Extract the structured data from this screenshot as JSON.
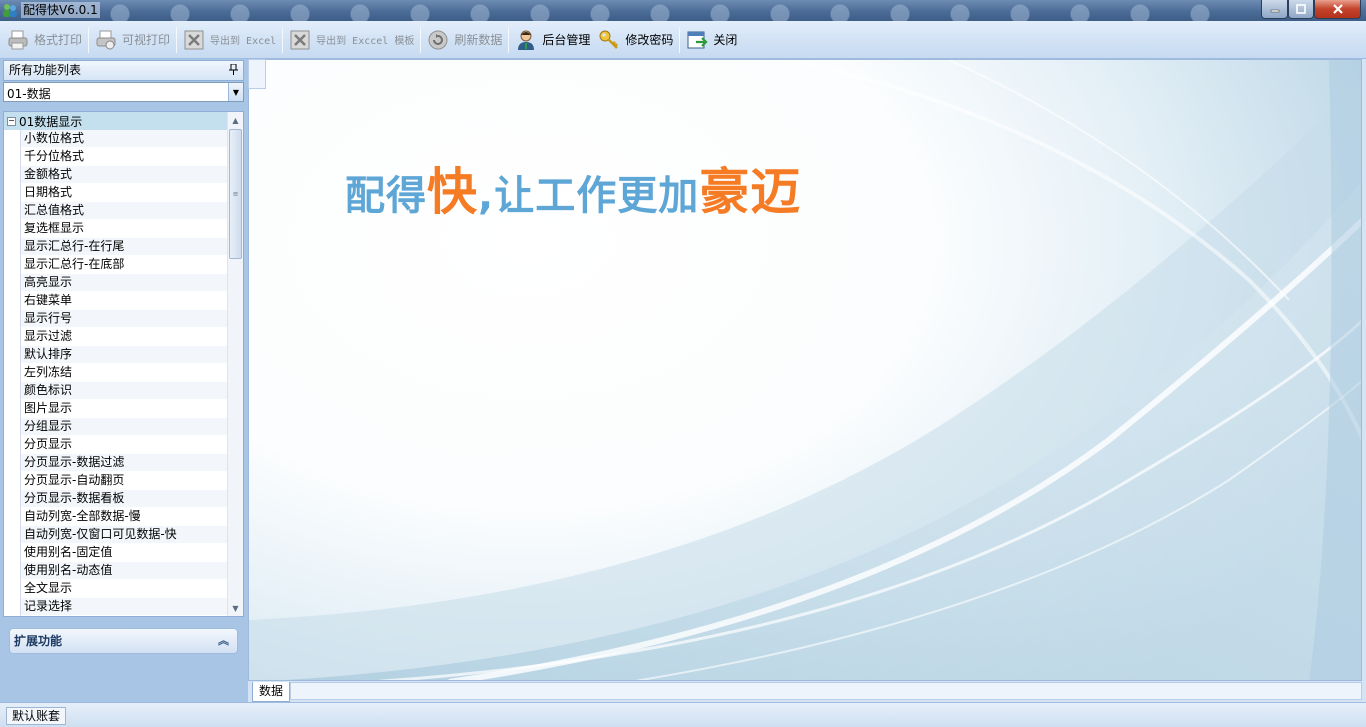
{
  "window": {
    "title": "配得快V6.0.1"
  },
  "toolbar": {
    "items": [
      {
        "label": "格式打印",
        "mono": false,
        "enabled": false,
        "icon": "printer-icon"
      },
      {
        "label": "可视打印",
        "mono": false,
        "enabled": false,
        "icon": "print-preview-icon"
      },
      {
        "label": "导出到 Excel",
        "mono": true,
        "enabled": false,
        "icon": "excel-export-icon"
      },
      {
        "label": "导出到 Exccel 模板",
        "mono": true,
        "enabled": false,
        "icon": "excel-template-icon"
      },
      {
        "label": "刷新数据",
        "mono": false,
        "enabled": false,
        "icon": "refresh-icon"
      },
      {
        "label": "后台管理",
        "mono": false,
        "enabled": true,
        "icon": "admin-user-icon"
      },
      {
        "label": "修改密码",
        "mono": false,
        "enabled": true,
        "icon": "key-icon"
      },
      {
        "label": "关闭",
        "mono": false,
        "enabled": true,
        "icon": "exit-icon"
      }
    ]
  },
  "sidebar": {
    "header": "所有功能列表",
    "combo_value": "01-数据",
    "tree_root": "01数据显示",
    "items": [
      "小数位格式",
      "千分位格式",
      "金额格式",
      "日期格式",
      "汇总值格式",
      "复选框显示",
      "显示汇总行-在行尾",
      "显示汇总行-在底部",
      "高亮显示",
      "右键菜单",
      "显示行号",
      "显示过滤",
      "默认排序",
      "左列冻结",
      "颜色标识",
      "图片显示",
      "分组显示",
      "分页显示",
      "分页显示-数据过滤",
      "分页显示-自动翻页",
      "分页显示-数据看板",
      "自动列宽-全部数据-慢",
      "自动列宽-仅窗口可见数据-快",
      "使用别名-固定值",
      "使用别名-动态值",
      "全文显示",
      "记录选择"
    ],
    "extension": "扩展功能"
  },
  "main": {
    "slogan": {
      "part1": "配得",
      "part2": "快",
      "part3": ",让工作更加",
      "part4": "豪迈"
    },
    "tab_label": "数据"
  },
  "status": {
    "account": "默认账套"
  },
  "colors": {
    "slogan_blue": "#5ea6d6",
    "slogan_orange": "#f57b25"
  }
}
